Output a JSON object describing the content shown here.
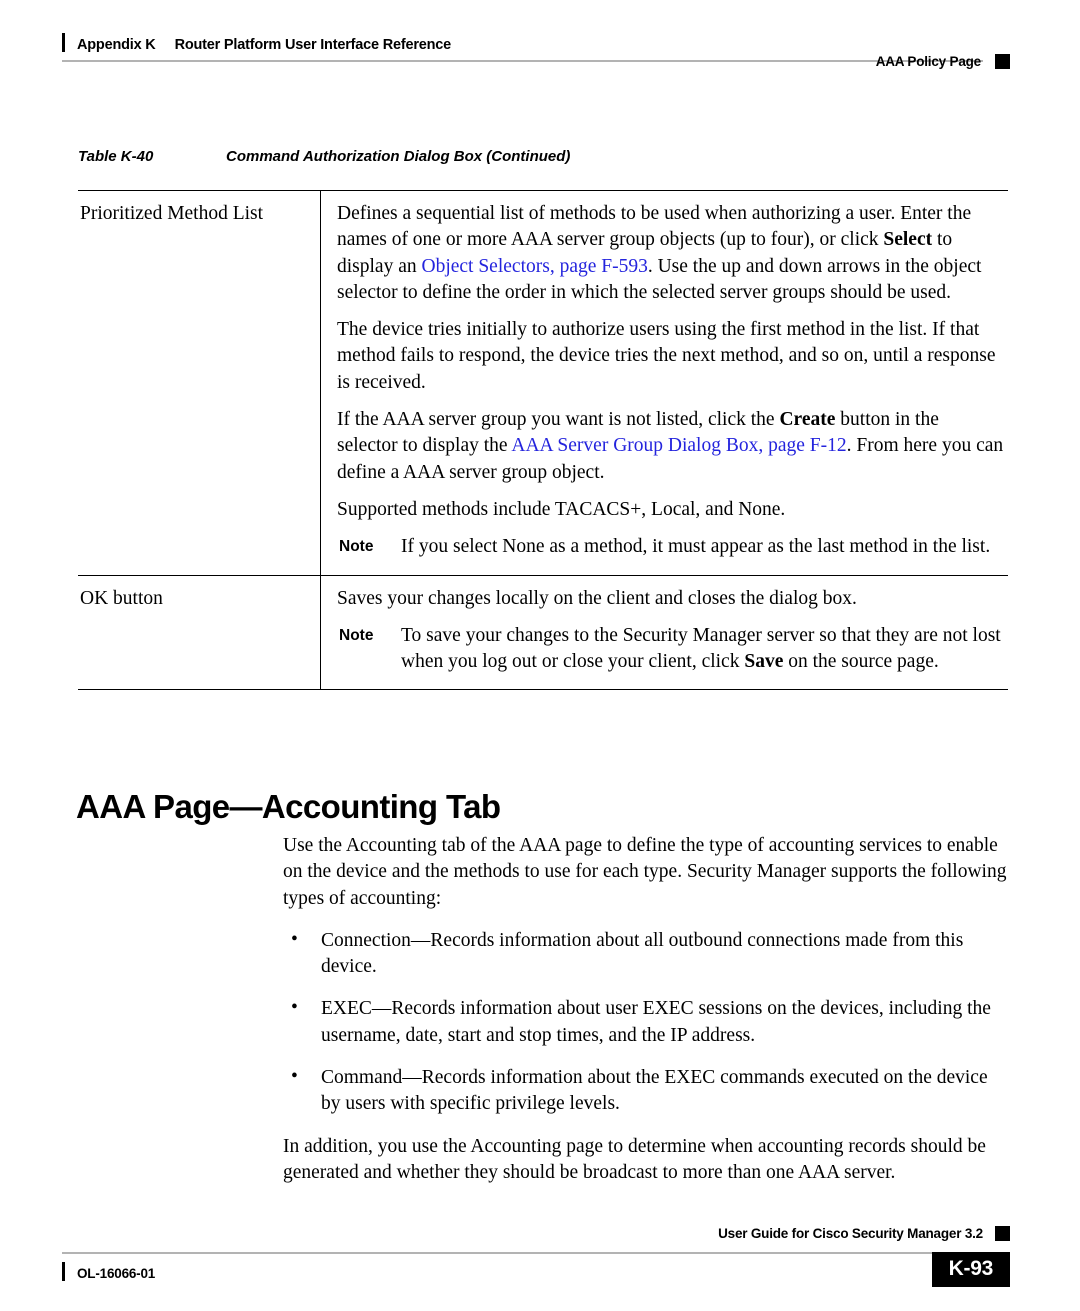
{
  "header": {
    "appendix": "Appendix K",
    "title": "Router Platform User Interface Reference",
    "section": "AAA Policy Page"
  },
  "table": {
    "caption_number": "Table K-40",
    "caption_title": "Command Authorization Dialog Box (Continued)",
    "rows": [
      {
        "label": "Prioritized Method List",
        "paragraphs": [
          {
            "type": "rich",
            "parts": [
              {
                "text": "Defines a sequential list of methods to be used when authorizing a user. Enter the names of one or more AAA server group objects (up to four), or click "
              },
              {
                "text": "Select",
                "style": "bold"
              },
              {
                "text": " to display an "
              },
              {
                "text": "Object Selectors, page F-593",
                "style": "link"
              },
              {
                "text": ". Use the up and down arrows in the object selector to define the order in which the selected server groups should be used."
              }
            ]
          },
          {
            "type": "plain",
            "text": "The device tries initially to authorize users using the first method in the list. If that method fails to respond, the device tries the next method, and so on, until a response is received."
          },
          {
            "type": "rich",
            "parts": [
              {
                "text": "If the AAA server group you want is not listed, click the "
              },
              {
                "text": "Create",
                "style": "bold"
              },
              {
                "text": " button in the selector to display the "
              },
              {
                "text": "AAA Server Group Dialog Box, page F-12",
                "style": "link"
              },
              {
                "text": ". From here you can define a AAA server group object."
              }
            ]
          },
          {
            "type": "plain",
            "text": "Supported methods include TACACS+, Local, and None."
          },
          {
            "type": "note",
            "label": "Note",
            "text": "If you select None as a method, it must appear as the last method in the list."
          }
        ]
      },
      {
        "label": "OK button",
        "paragraphs": [
          {
            "type": "plain",
            "text": "Saves your changes locally on the client and closes the dialog box."
          },
          {
            "type": "note",
            "label": "Note",
            "parts": [
              {
                "text": "To save your changes to the Security Manager server so that they are not lost when you log out or close your client, click "
              },
              {
                "text": "Save",
                "style": "bold"
              },
              {
                "text": " on the source page."
              }
            ]
          }
        ]
      }
    ]
  },
  "section": {
    "heading": "AAA Page—Accounting Tab",
    "intro": "Use the Accounting tab of the AAA page to define the type of accounting services to enable on the device and the methods to use for each type. Security Manager supports the following types of accounting:",
    "bullet_glyph": "•",
    "bullets": [
      "Connection—Records information about all outbound connections made from this device.",
      "EXEC—Records information about user EXEC sessions on the devices, including the username, date, start and stop times, and the IP address.",
      "Command—Records information about the EXEC commands executed on the device by users with specific privilege levels."
    ],
    "closing": "In addition, you use the Accounting page to determine when accounting records should be generated and whether they should be broadcast to more than one AAA server."
  },
  "footer": {
    "guide": "User Guide for Cisco Security Manager 3.2",
    "doc_id": "OL-16066-01",
    "page_number": "K-93"
  },
  "colors": {
    "link": "#2424dd",
    "rule": "#b3b3b3",
    "text": "#000000"
  }
}
